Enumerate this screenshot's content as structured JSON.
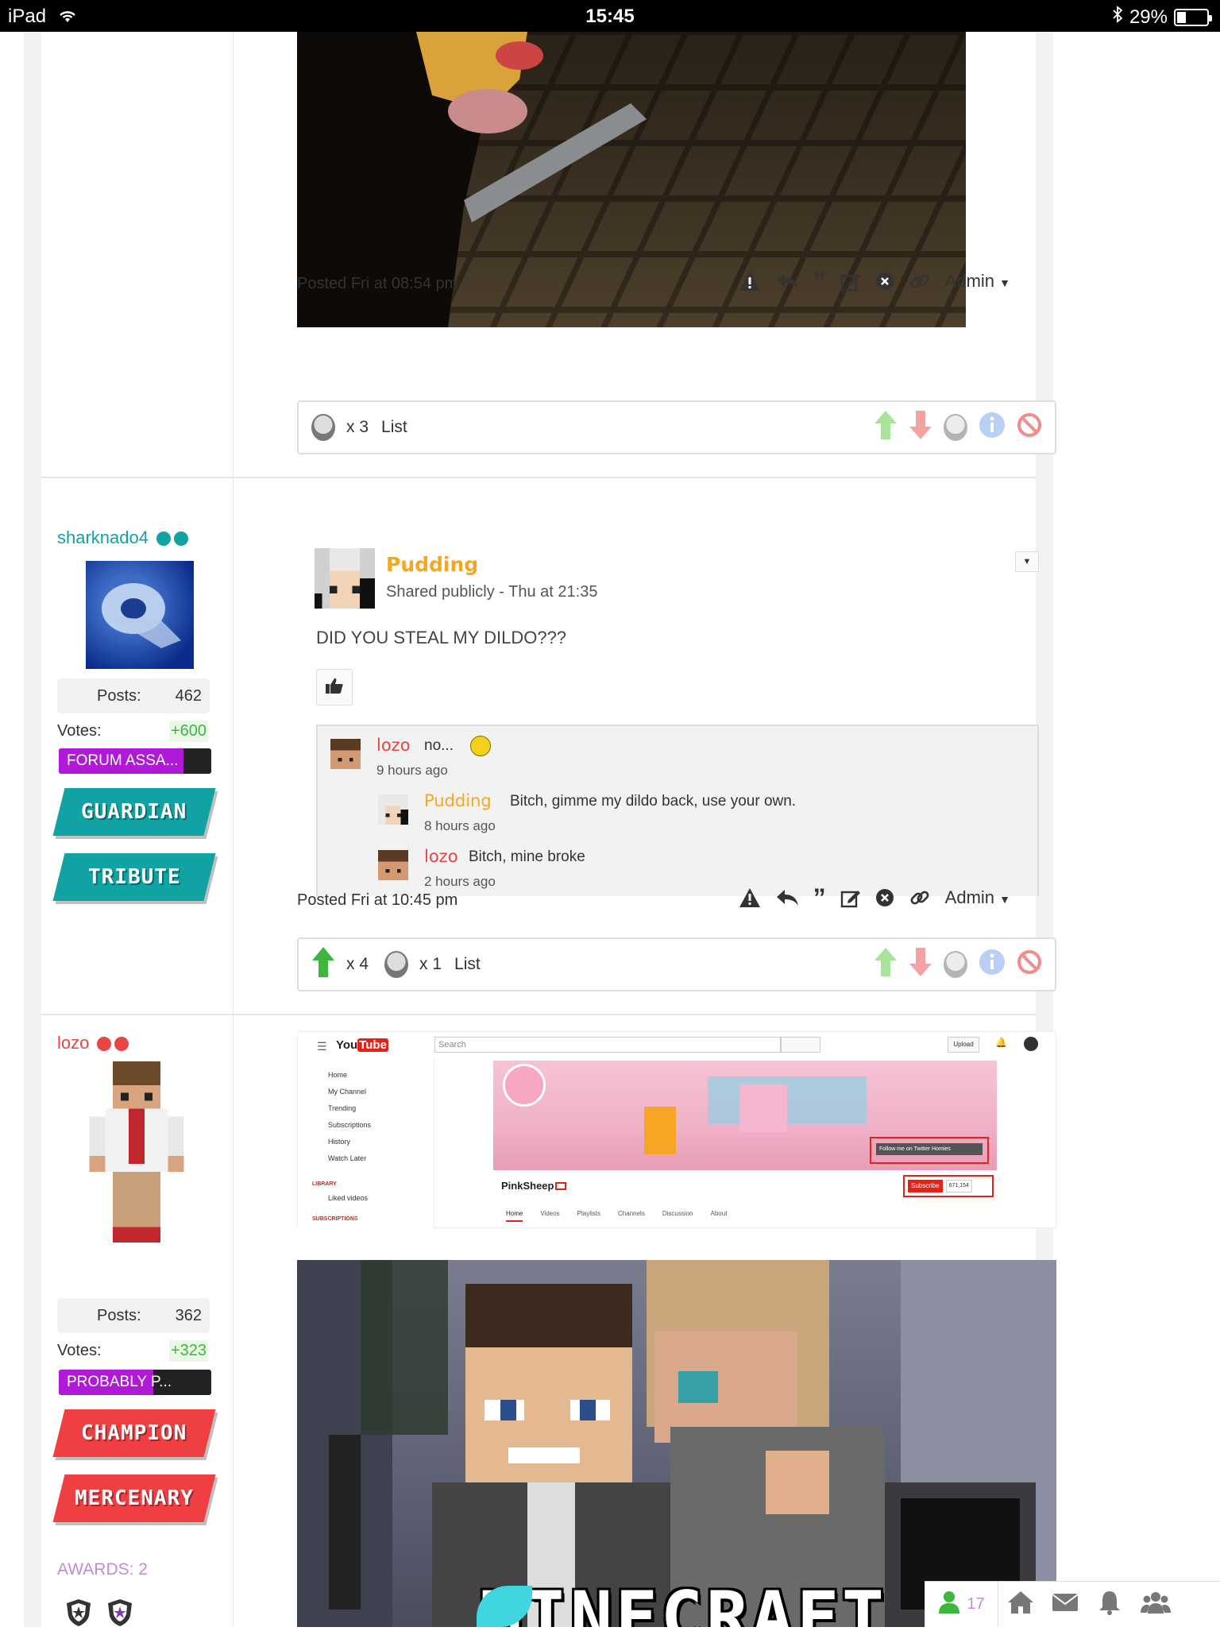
{
  "status_bar": {
    "device": "iPad",
    "time": "15:45",
    "battery": "29%"
  },
  "post1": {
    "posted": "Posted Fri at 08:54 pm",
    "admin_label": "Admin",
    "vote_count": "x 3",
    "list_label": "List"
  },
  "post2": {
    "author": {
      "name": "sharknado4",
      "posts_label": "Posts:",
      "posts": "462",
      "votes_label": "Votes:",
      "votes": "+600",
      "rank": "FORUM ASSA...",
      "badges": [
        "GUARDIAN",
        "TRIBUTE"
      ],
      "name_color": "#11a3a3",
      "accent": "#11a3a3"
    },
    "card": {
      "name": "Pudding",
      "meta": "Shared publicly - Thu at 21:35",
      "text": "DID YOU STEAL MY DILDO???",
      "comments": [
        {
          "name": "lozo",
          "text": "no...",
          "time": "9 hours ago"
        },
        {
          "name": "Pudding",
          "text": "Bitch, gimme my dildo back, use your own.",
          "time": "8 hours ago"
        },
        {
          "name": "lozo",
          "text": "Bitch, mine broke",
          "time": "2 hours ago"
        }
      ]
    },
    "posted": "Posted Fri at 10:45 pm",
    "admin_label": "Admin",
    "up_count": "x 4",
    "face_count": "x 1",
    "list_label": "List"
  },
  "post3": {
    "author": {
      "name": "lozo",
      "posts_label": "Posts:",
      "posts": "362",
      "votes_label": "Votes:",
      "votes": "+323",
      "rank": "PROBABLY P...",
      "badges": [
        "CHAMPION",
        "MERCENARY"
      ],
      "awards": "AWARDS: 2",
      "name_color": "#e84545"
    },
    "youtube": {
      "search_placeholder": "Search",
      "upload": "Upload",
      "nav": [
        "Home",
        "My Channel",
        "Trending",
        "Subscriptions",
        "History",
        "Watch Later"
      ],
      "library_label": "LIBRARY",
      "liked": "Liked videos",
      "subs_label": "SUBSCRIPTIONS",
      "channel": "PinkSheep",
      "twitter": "Follow me on Twitter Homies",
      "subscribe": "Subscribe",
      "sub_count": "671,154",
      "tabs": [
        "Home",
        "Videos",
        "Playlists",
        "Channels",
        "Discussion",
        "About"
      ]
    },
    "thumbnail_title": "MINECRAFT"
  },
  "floating_bar": {
    "online_count": "17"
  },
  "colors": {
    "teal": "#11a3a3",
    "red": "#e84545",
    "orange": "#f6a623",
    "purple_rank": "#b019d8",
    "green": "#3db63d"
  }
}
